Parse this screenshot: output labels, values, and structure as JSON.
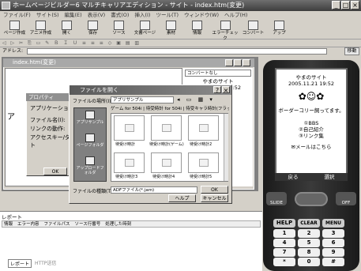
{
  "window": {
    "title": "ホームページビルダー6 マルチキャリアエディション - サイト - index.htm(変更)"
  },
  "menu": [
    "ファイル(F)",
    "サイト(S)",
    "編集(E)",
    "表示(V)",
    "書式(O)",
    "挿入(I)",
    "ツール(T)",
    "ウィンドウ(W)",
    "ヘルプ(H)"
  ],
  "toolbar": [
    "ページ作成",
    "アニメ作成",
    "開く",
    "保存",
    "ソース",
    "文書ページ",
    "素材",
    "情報",
    "エラーチェック",
    "コンバート",
    "アップ"
  ],
  "toolbar2_text": "◁ ▷ ✂ ⎘ ▭ ✎ Ｂ Ｉ Ｕ ≡ ≡ ≡ ◇ ▣ ▤ ▥",
  "address": {
    "label": "アドレス:",
    "go": "移動"
  },
  "doc": {
    "title": "index.htm(変更)",
    "left_text": "ア"
  },
  "preview": {
    "combo": "コンバートなし",
    "title": "やまのサイト",
    "date": "2005.11.21 19:52"
  },
  "properties": {
    "title": "プロパティ",
    "items": [
      "アプリケーション名",
      "ファイル名(I):",
      "リンクの動作:",
      "アクセスキー/ダイレクト"
    ],
    "ok": "OK"
  },
  "file_dialog": {
    "title": "ファイルを開く",
    "look_in_label": "ファイルの場所(I):",
    "look_in_value": "アプリサンプル",
    "places": [
      "アプリサンプル",
      "ページフォルダ",
      "アップロードフォルダ"
    ],
    "tabs": "ゲーム for 504i | 待受時計 for 504i | 待受キャラ時計(フラッシ",
    "thumbs": [
      "待受け時計",
      "待受け時計(ゲーム)",
      "待受け時計2",
      "待受け時計3",
      "待受け時計4",
      "待受け時計5"
    ],
    "type_label": "ファイルの種類(T):",
    "type_value": "ADFファイル(*.jam)",
    "ok": "OK",
    "help": "ヘルプ",
    "cancel": "キャンセル"
  },
  "report": {
    "label": "レポート",
    "columns": [
      "情報",
      "エラー内容",
      "ファイルパス",
      "ソース行番号",
      "処理した時刻"
    ],
    "tabs": [
      "レポート",
      "HTTP送信"
    ]
  },
  "phone": {
    "title": "やまのサイト",
    "date": "2005.11.21 19:52",
    "body": "ボーダーコリー飼ってます。",
    "menu": [
      "①BBS",
      "②自己紹介",
      "③リンク集"
    ],
    "mail": "✉メールはこちら",
    "softkeys": [
      "戻る",
      "選択"
    ],
    "side_keys": [
      "SLIDE",
      "OFF"
    ],
    "function_keys": [
      "HELP",
      "CLEAR",
      "MENU"
    ],
    "keys": [
      "1",
      "2",
      "3",
      "4",
      "5",
      "6",
      "7",
      "8",
      "9",
      "*",
      "0",
      "#"
    ]
  },
  "colors": {
    "titlebar": "#3d3d3d",
    "phone_body": "#2a2a2a",
    "desktop": "#d4d0c8"
  }
}
